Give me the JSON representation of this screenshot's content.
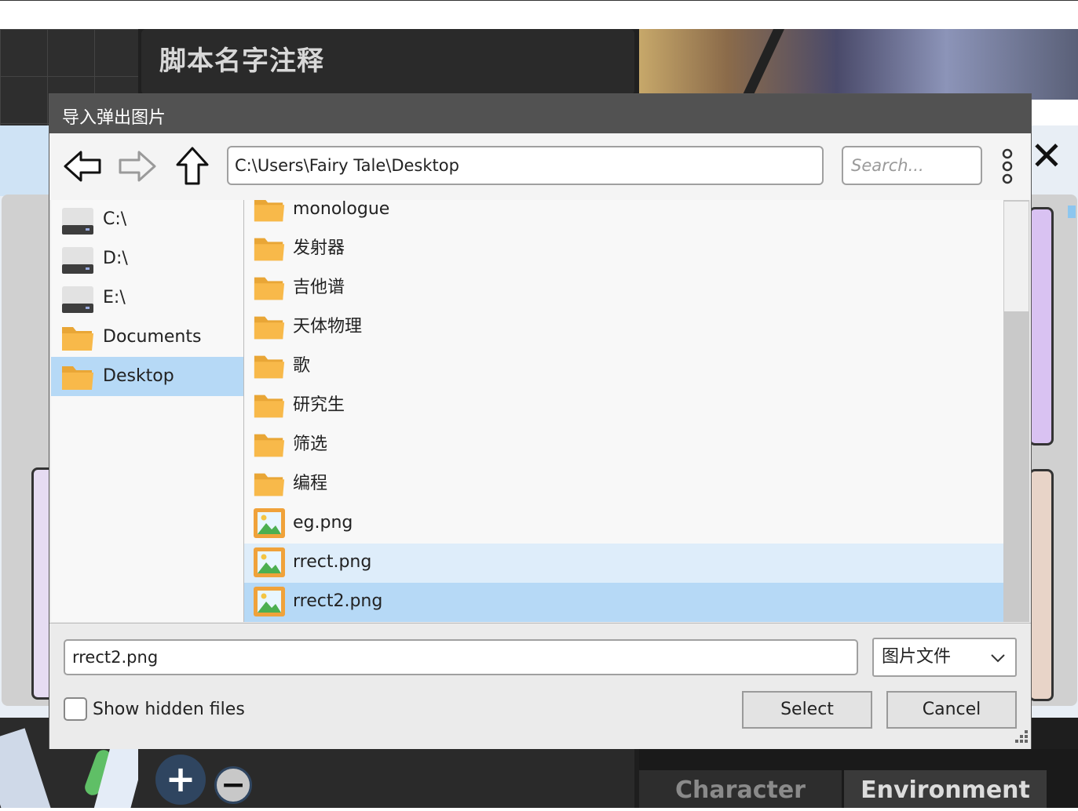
{
  "background_app": {
    "panel_title": "脚本名字注释",
    "close_glyph": "✕",
    "add_glyph": "+",
    "remove_glyph": "−",
    "tabs": [
      {
        "label": "Character",
        "active": false
      },
      {
        "label": "Environment",
        "active": true
      }
    ]
  },
  "dialog": {
    "title": "导入弹出图片",
    "toolbar": {
      "back_icon": "back-arrow-icon",
      "forward_icon": "forward-arrow-icon",
      "up_icon": "up-arrow-icon",
      "path": "C:\\Users\\Fairy Tale\\Desktop",
      "search_placeholder": "Search...",
      "more_icon": "more-options-icon"
    },
    "sidebar": {
      "items": [
        {
          "label": "C:\\",
          "icon": "drive-icon",
          "selected": false
        },
        {
          "label": "D:\\",
          "icon": "drive-icon",
          "selected": false
        },
        {
          "label": "E:\\",
          "icon": "drive-icon",
          "selected": false
        },
        {
          "label": "Documents",
          "icon": "folder-icon",
          "selected": false
        },
        {
          "label": "Desktop",
          "icon": "folder-icon",
          "selected": true
        }
      ]
    },
    "files": [
      {
        "name": "monologue",
        "type": "folder",
        "state": "normal"
      },
      {
        "name": "发射器",
        "type": "folder",
        "state": "normal"
      },
      {
        "name": "吉他谱",
        "type": "folder",
        "state": "normal"
      },
      {
        "name": "天体物理",
        "type": "folder",
        "state": "normal"
      },
      {
        "name": "歌",
        "type": "folder",
        "state": "normal"
      },
      {
        "name": "研究生",
        "type": "folder",
        "state": "normal"
      },
      {
        "name": "筛选",
        "type": "folder",
        "state": "normal"
      },
      {
        "name": "编程",
        "type": "folder",
        "state": "normal"
      },
      {
        "name": "eg.png",
        "type": "image",
        "state": "normal"
      },
      {
        "name": "rrect.png",
        "type": "image",
        "state": "hover"
      },
      {
        "name": "rrect2.png",
        "type": "image",
        "state": "selected"
      }
    ],
    "filename_value": "rrect2.png",
    "filter_value": "图片文件",
    "show_hidden_label": "Show hidden files",
    "show_hidden_checked": false,
    "select_label": "Select",
    "cancel_label": "Cancel"
  },
  "colors": {
    "selection": "#b6d9f6",
    "hover": "#deedfa",
    "folder": "#f8b94a",
    "titlebar": "#525252"
  }
}
